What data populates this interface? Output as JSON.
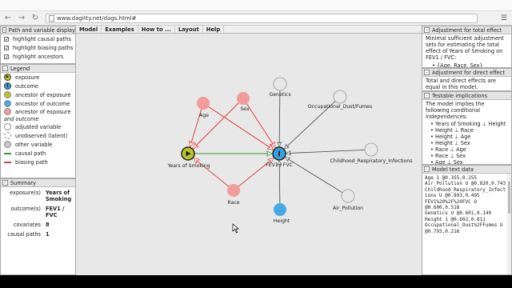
{
  "browser": {
    "url": "www.dagitty.net/dags.html#"
  },
  "menu": [
    "Model",
    "Examples",
    "How to ...",
    "Layout",
    "Help"
  ],
  "left": {
    "display": {
      "title": "Path and variable display",
      "options": [
        {
          "label": "highlight causal paths",
          "checked": true
        },
        {
          "label": "highlight biasing paths",
          "checked": true
        },
        {
          "label": "highlight ancestors",
          "checked": true
        }
      ]
    },
    "legend": {
      "title": "Legend",
      "items": [
        {
          "label": "exposure",
          "kind": "exposure"
        },
        {
          "label": "outcome",
          "kind": "outcome"
        },
        {
          "label": "ancestor of exposure",
          "kind": "anc-exp"
        },
        {
          "label": "ancestor of outcome",
          "kind": "anc-out"
        },
        {
          "label": "ancestor of exposure",
          "label2": "and outcome",
          "kind": "anc-both"
        },
        {
          "label": "adjusted variable",
          "kind": "adjusted"
        },
        {
          "label": "unobserved (latent)",
          "kind": "latent"
        },
        {
          "label": "other variable",
          "kind": "other"
        },
        {
          "label": "causal path",
          "kind": "causal"
        },
        {
          "label": "biasing path",
          "kind": "biasing"
        }
      ]
    },
    "summary": {
      "title": "Summary",
      "rows": [
        {
          "k": "exposure(s)",
          "v": "Years of Smoking"
        },
        {
          "k": "outcome(s)",
          "v": "FEV1 / FVC"
        },
        {
          "k": "covariates",
          "v": "8"
        },
        {
          "k": "causal paths",
          "v": "1"
        }
      ]
    }
  },
  "right": {
    "total": {
      "title": "Adjustment for total effect",
      "text": "Minimal sufficient adjustment sets for estimating the total effect of Years of Smoking on FEV1 / FVC:",
      "sets": [
        "{Age, Race, Sex}"
      ]
    },
    "direct": {
      "title": "Adjustment for direct effect",
      "text": "Total and direct effects are equal in this model."
    },
    "testable": {
      "title": "Testable implications",
      "text": "The model implies the following conditional independences:",
      "items": [
        "Years of Smoking ⊥ Height",
        "Height ⊥ Race",
        "Height ⊥ Age",
        "Height ⊥ Sex",
        "Race ⊥ Age",
        "Race ⊥ Sex",
        "Age ⊥ Sex"
      ]
    },
    "model": {
      "title": "Model text data",
      "lines": [
        "Age 1 @0.355,0.255",
        "Air_Pollution U @0.820,0.743",
        "Childhood_Respiratory_Infect",
        "ions U @0.893,0.495",
        "FEV1%20%2F%20FVC O",
        "@0.600,0.518",
        "Genetics U @0.601,0.149",
        "Height 1 @0.602,0.811",
        "Occupational_Dust%2FFumes U",
        "@0.793,0.216"
      ]
    }
  },
  "graph": {
    "nodes": [
      {
        "id": "age",
        "label": "Age",
        "kind": "anc-both"
      },
      {
        "id": "sex",
        "label": "Sex",
        "kind": "anc-both"
      },
      {
        "id": "race",
        "label": "Race",
        "kind": "anc-both"
      },
      {
        "id": "smoking",
        "label": "Years of Smoking",
        "kind": "exposure"
      },
      {
        "id": "fev",
        "label": "FEV1 / FVC",
        "kind": "outcome"
      },
      {
        "id": "genetics",
        "label": "Genetics",
        "kind": "other"
      },
      {
        "id": "dust",
        "label": "Occupational_Dust/Fumes",
        "kind": "other"
      },
      {
        "id": "childhood",
        "label": "Childhood_Respiratory_Infections",
        "kind": "other"
      },
      {
        "id": "air",
        "label": "Air_Pollution",
        "kind": "other"
      },
      {
        "id": "height",
        "label": "Height",
        "kind": "anc-out"
      }
    ],
    "edges": [
      {
        "from": "age",
        "to": "smoking",
        "kind": "biasing"
      },
      {
        "from": "age",
        "to": "fev",
        "kind": "biasing"
      },
      {
        "from": "sex",
        "to": "smoking",
        "kind": "biasing"
      },
      {
        "from": "sex",
        "to": "fev",
        "kind": "biasing"
      },
      {
        "from": "race",
        "to": "smoking",
        "kind": "biasing"
      },
      {
        "from": "race",
        "to": "fev",
        "kind": "biasing"
      },
      {
        "from": "smoking",
        "to": "fev",
        "kind": "causal"
      },
      {
        "from": "genetics",
        "to": "fev",
        "kind": "plain"
      },
      {
        "from": "dust",
        "to": "fev",
        "kind": "plain"
      },
      {
        "from": "childhood",
        "to": "fev",
        "kind": "plain"
      },
      {
        "from": "air",
        "to": "fev",
        "kind": "plain"
      },
      {
        "from": "height",
        "to": "fev",
        "kind": "plain"
      }
    ]
  },
  "colors": {
    "exposure": "#b8c42a",
    "outcome": "#3aa0dd",
    "anc-exp": "#b8c42a",
    "anc-out": "#46a8e6",
    "anc-both": "#f29b9b",
    "adjusted": "#ffffff",
    "latent": "#ffffff",
    "other": "#c8c8c8",
    "causal": "#27a02a",
    "biasing": "#e04040",
    "plain": "#333333"
  }
}
